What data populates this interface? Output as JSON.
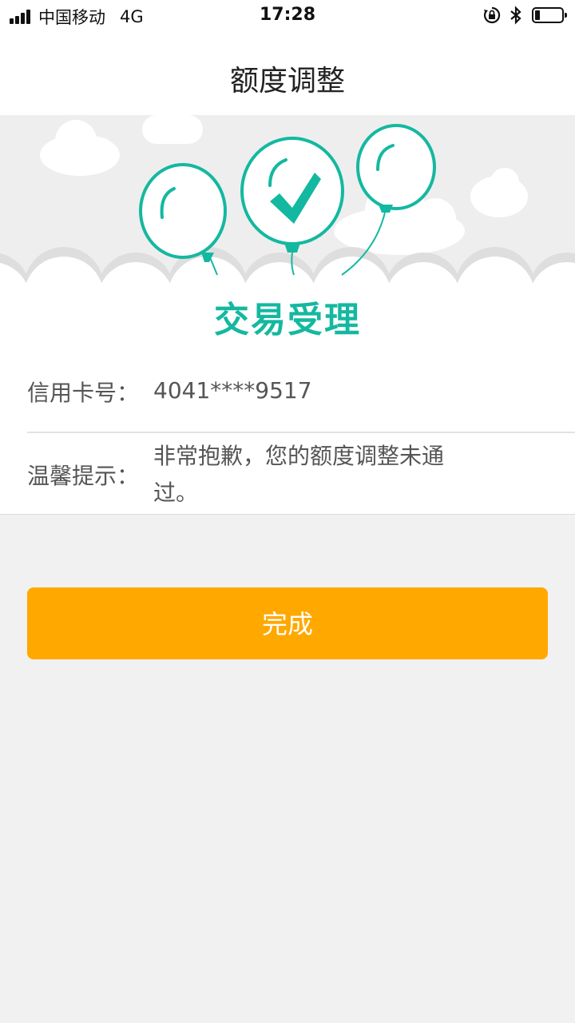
{
  "status_bar": {
    "carrier": "中国移动",
    "network": "4G",
    "time": "17:28",
    "icons": [
      "signal-icon",
      "orientation-lock-icon",
      "bluetooth-icon",
      "battery-icon"
    ],
    "battery_level": 0.2
  },
  "nav": {
    "title": "额度调整"
  },
  "hero": {
    "title": "交易受理",
    "accent_color": "#14b8a0",
    "icons": [
      "balloon-icon",
      "checkmark-balloon-icon",
      "balloon-icon",
      "cloud-icon"
    ]
  },
  "info": {
    "card_label": "信用卡号：",
    "card_value": "4041****9517",
    "tip_label": "温馨提示：",
    "tip_value": "非常抱歉，您的额度调整未通过。"
  },
  "actions": {
    "done_label": "完成",
    "done_color": "#ffa800"
  }
}
